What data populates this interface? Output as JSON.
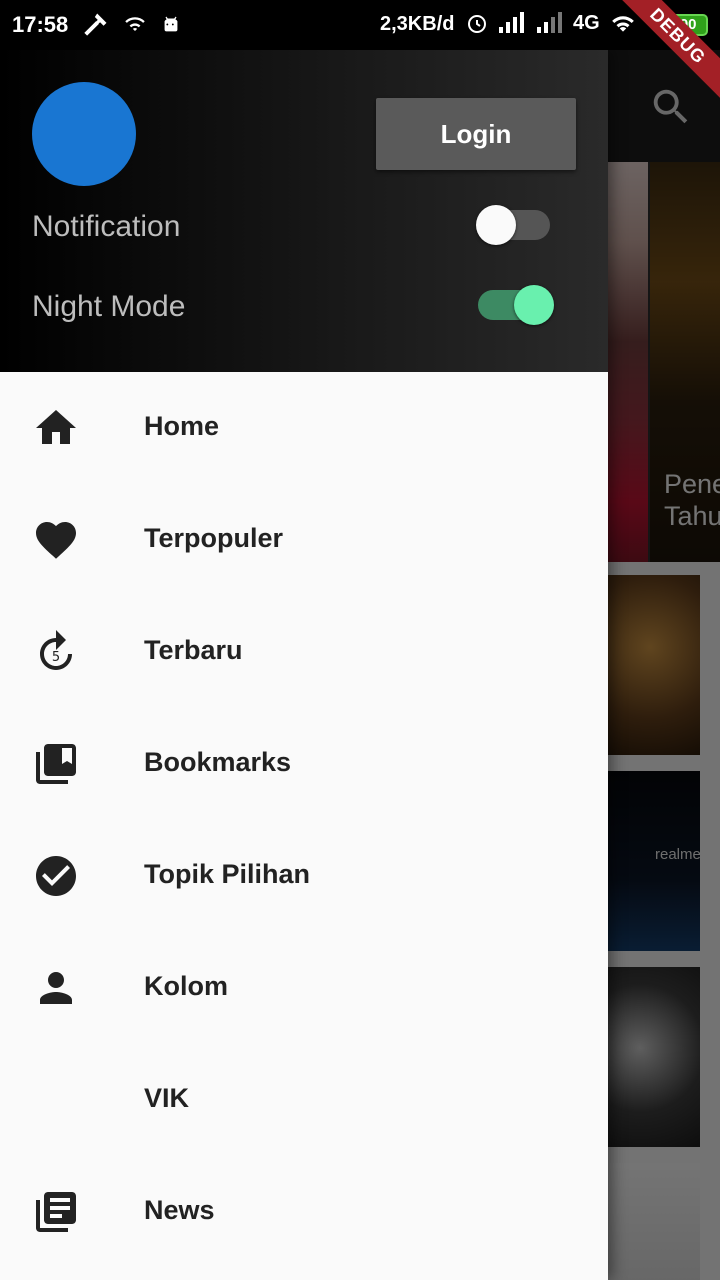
{
  "status_bar": {
    "time": "17:58",
    "data_rate": "2,3KB/d",
    "network": "4G",
    "battery": "100",
    "debug_banner": "DEBUG"
  },
  "background": {
    "hero_text": "Pene\nTahu",
    "thumb_text": "realme"
  },
  "drawer": {
    "login_label": "Login",
    "toggles": [
      {
        "label": "Notification",
        "on": false
      },
      {
        "label": "Night Mode",
        "on": true
      }
    ],
    "menu": [
      {
        "label": "Home",
        "icon": "home-icon"
      },
      {
        "label": "Terpopuler",
        "icon": "heart-icon"
      },
      {
        "label": "Terbaru",
        "icon": "replay-5-icon"
      },
      {
        "label": "Bookmarks",
        "icon": "bookmarks-icon"
      },
      {
        "label": "Topik Pilihan",
        "icon": "check-circle-icon"
      },
      {
        "label": "Kolom",
        "icon": "person-icon"
      },
      {
        "label": "VIK",
        "icon": ""
      },
      {
        "label": "News",
        "icon": "news-icon"
      }
    ]
  },
  "colors": {
    "avatar": "#1976d2",
    "switch_on_knob": "#69f0ae",
    "switch_on_track": "#3d8a63",
    "debug_banner": "#a32026"
  }
}
